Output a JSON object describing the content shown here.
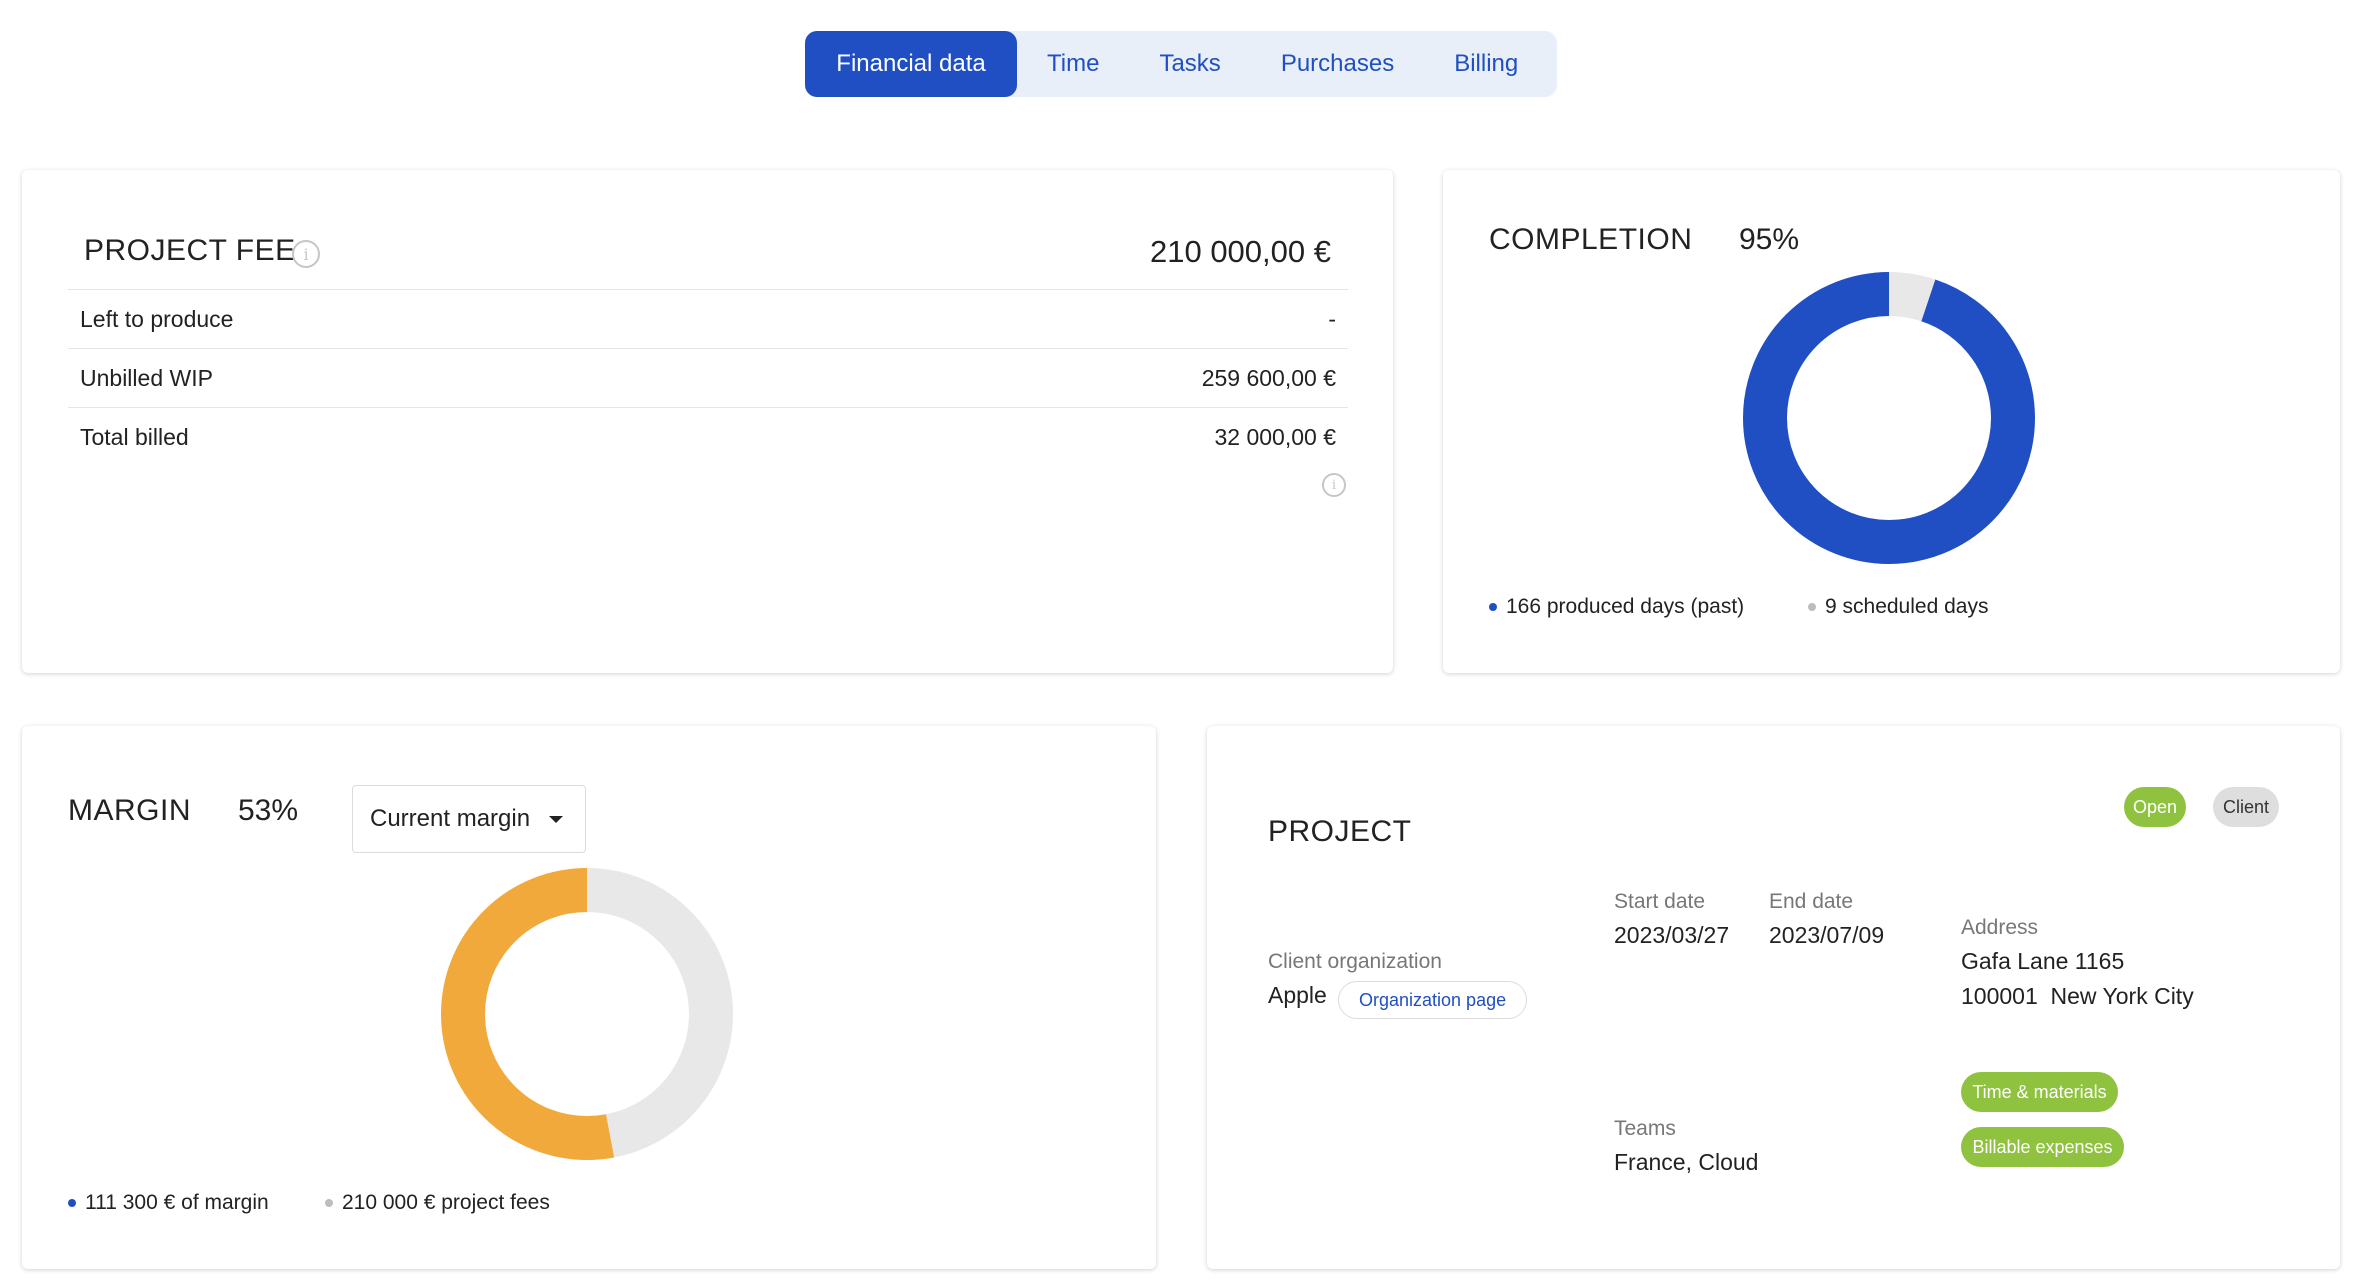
{
  "tabs": [
    "Financial data",
    "Time",
    "Tasks",
    "Purchases",
    "Billing"
  ],
  "active_tab": "Financial data",
  "project_fee": {
    "title": "PROJECT FEE",
    "info_icon": "info-icon",
    "total": "210 000,00 €",
    "rows": [
      {
        "label": "Left to produce",
        "value": "-"
      },
      {
        "label": "Unbilled WIP",
        "value": "259 600,00 €"
      },
      {
        "label": "Total billed",
        "value": "32 000,00 €"
      }
    ]
  },
  "completion": {
    "title": "COMPLETION",
    "percent": "95%",
    "legend": [
      "166 produced days (past)",
      "9 scheduled days"
    ]
  },
  "margin": {
    "title": "MARGIN",
    "percent": "53%",
    "select_value": "Current margin",
    "legend": [
      "111 300 € of margin",
      "210 000 € project fees"
    ]
  },
  "project": {
    "title": "PROJECT",
    "badges": [
      "Open",
      "Client"
    ],
    "client_org_label": "Client organization",
    "client_org_value": "Apple",
    "org_page_button": "Organization page",
    "start_date_label": "Start date",
    "start_date_value": "2023/03/27",
    "end_date_label": "End date",
    "end_date_value": "2023/07/09",
    "address_label": "Address",
    "address_line1": "Gafa Lane 1165",
    "address_line2": "100001  New York City",
    "teams_label": "Teams",
    "teams_value": "France, Cloud",
    "tags": [
      "Time & materials",
      "Billable expenses"
    ]
  },
  "chart_data": [
    {
      "type": "pie",
      "title": "COMPLETION",
      "labels": [
        "166 produced days (past)",
        "9 scheduled days"
      ],
      "values": [
        166,
        9
      ],
      "colors": [
        "#1f4fc2",
        "#e8e8e8"
      ]
    },
    {
      "type": "pie",
      "title": "MARGIN",
      "labels": [
        "111 300 € of margin",
        "210 000 € project fees"
      ],
      "values": [
        111300,
        98700
      ],
      "colors": [
        "#f2a93b",
        "#e8e8e8"
      ],
      "legend_dot_colors": [
        "#1f4fc2",
        "#bdbdbd"
      ]
    }
  ],
  "colors": {
    "accent": "#1f4fc2",
    "tab_bg": "#e9eff8",
    "margin": "#f2a93b",
    "remainder": "#e8e8e8",
    "green": "#8fc33f"
  }
}
